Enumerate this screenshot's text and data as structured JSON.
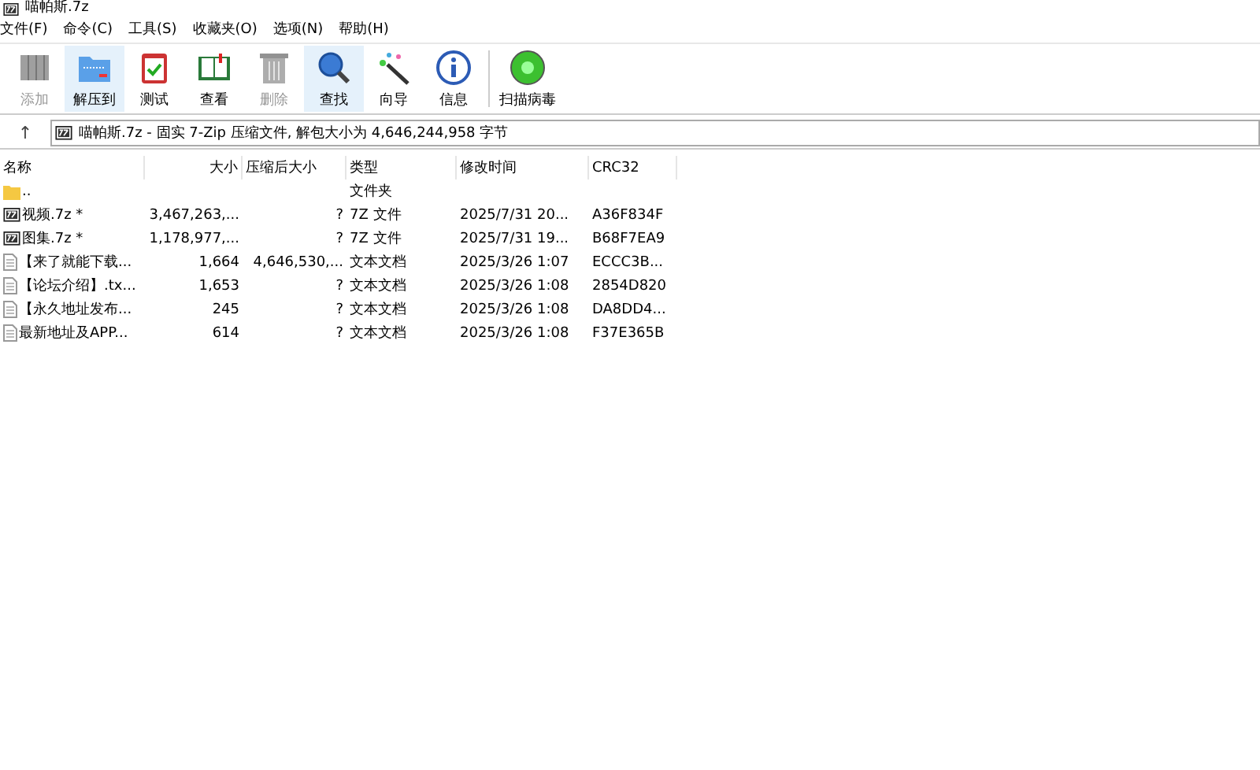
{
  "window": {
    "title": "喵帕斯.7z"
  },
  "menu": [
    "文件(F)",
    "命令(C)",
    "工具(S)",
    "收藏夹(O)",
    "选项(N)",
    "帮助(H)"
  ],
  "toolbar": [
    {
      "label": "添加",
      "kind": "add",
      "disabled": true,
      "selected": false
    },
    {
      "label": "解压到",
      "kind": "extract",
      "disabled": false,
      "selected": true
    },
    {
      "label": "测试",
      "kind": "test",
      "disabled": false,
      "selected": false
    },
    {
      "label": "查看",
      "kind": "view",
      "disabled": false,
      "selected": false
    },
    {
      "label": "删除",
      "kind": "delete",
      "disabled": true,
      "selected": false
    },
    {
      "label": "查找",
      "kind": "find",
      "disabled": false,
      "selected": true
    },
    {
      "label": "向导",
      "kind": "wizard",
      "disabled": false,
      "selected": false
    },
    {
      "label": "信息",
      "kind": "info",
      "disabled": false,
      "selected": false
    },
    {
      "label": "扫描病毒",
      "kind": "virus",
      "disabled": false,
      "selected": false
    }
  ],
  "address": {
    "up": "↑",
    "path": "喵帕斯.7z - 固实 7-Zip 压缩文件, 解包大小为 4,646,244,958 字节"
  },
  "table": {
    "columns": [
      "名称",
      "大小",
      "压缩后大小",
      "类型",
      "修改时间",
      "CRC32"
    ],
    "rows": [
      {
        "kind": "folder",
        "cells": [
          "..",
          "",
          "",
          "文件夹",
          "",
          ""
        ]
      },
      {
        "kind": "archive",
        "cells": [
          "视频.7z *",
          "3,467,263,...",
          "?",
          "7Z 文件",
          "2025/7/31 20...",
          "A36F834F"
        ]
      },
      {
        "kind": "archive",
        "cells": [
          "图集.7z *",
          "1,178,977,...",
          "?",
          "7Z 文件",
          "2025/7/31 19...",
          "B68F7EA9"
        ]
      },
      {
        "kind": "text",
        "cells": [
          "【来了就能下载...",
          "1,664",
          "4,646,530,...",
          "文本文档",
          "2025/3/26 1:07",
          "ECCC3B..."
        ]
      },
      {
        "kind": "text",
        "cells": [
          "【论坛介绍】.tx...",
          "1,653",
          "?",
          "文本文档",
          "2025/3/26 1:08",
          "2854D820"
        ]
      },
      {
        "kind": "text",
        "cells": [
          "【永久地址发布...",
          "245",
          "?",
          "文本文档",
          "2025/3/26 1:08",
          "DA8DD4..."
        ]
      },
      {
        "kind": "text",
        "cells": [
          "最新地址及APP...",
          "614",
          "?",
          "文本文档",
          "2025/3/26 1:08",
          "F37E365B"
        ]
      }
    ]
  }
}
